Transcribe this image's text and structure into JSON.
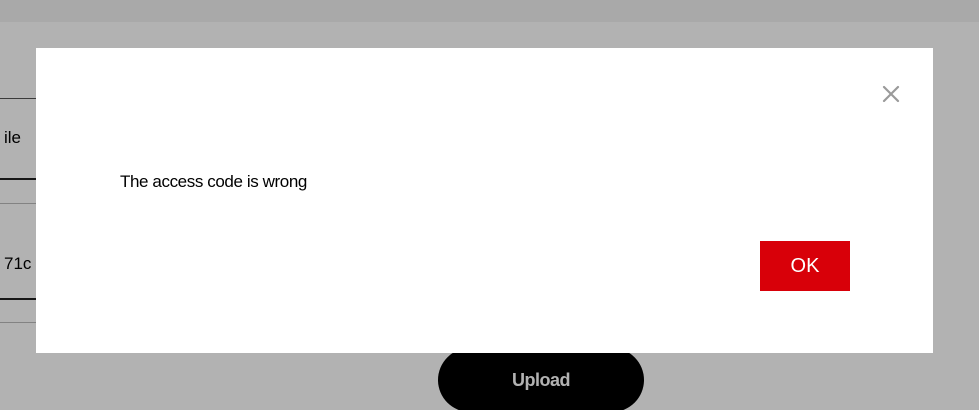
{
  "background": {
    "banner_text": "",
    "file_label_fragment": "ile",
    "code_value_fragment": "71c",
    "upload_label": "Upload"
  },
  "dialog": {
    "message": "The access code is wrong",
    "ok_label": "OK",
    "close_icon": "close-icon"
  },
  "colors": {
    "ok_button": "#d80009",
    "upload_button": "#000000",
    "overlay": "rgba(0,0,0,0.30)"
  }
}
